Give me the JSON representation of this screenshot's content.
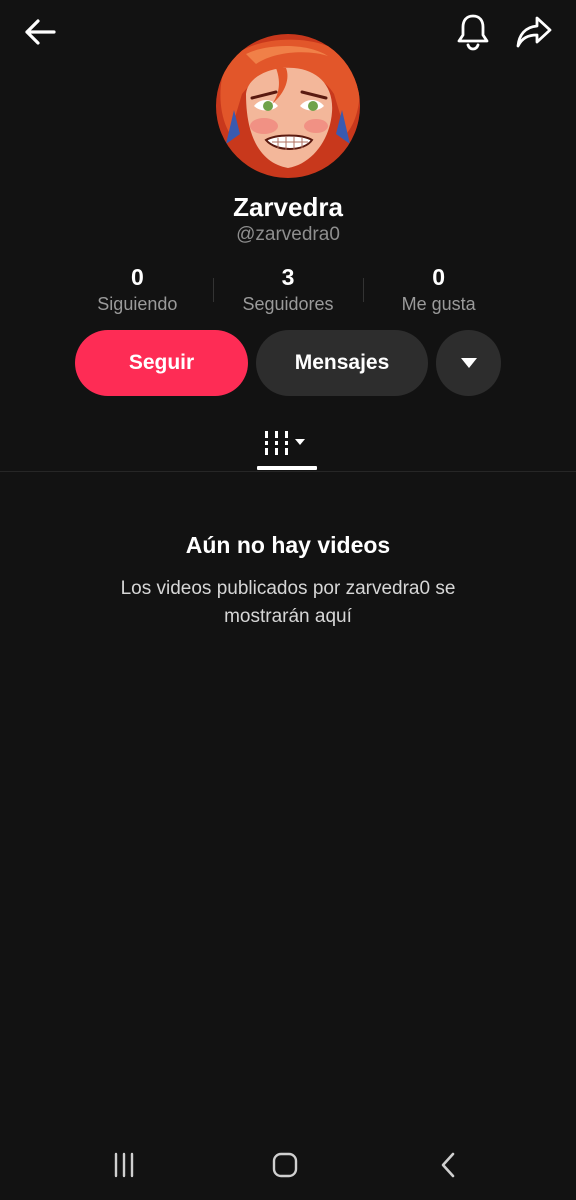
{
  "header": {
    "back_icon": "arrow-left-icon",
    "bell_icon": "bell-icon",
    "share_icon": "share-arrow-icon"
  },
  "profile": {
    "display_name": "Zarvedra",
    "username": "@zarvedra0"
  },
  "stats": [
    {
      "value": "0",
      "label": "Siguiendo"
    },
    {
      "value": "3",
      "label": "Seguidores"
    },
    {
      "value": "0",
      "label": "Me gusta"
    }
  ],
  "actions": {
    "follow_label": "Seguir",
    "message_label": "Mensajes",
    "more_icon": "caret-down-icon"
  },
  "tabs": {
    "videos_icon": "video-grid-icon"
  },
  "empty_state": {
    "title": "Aún no hay videos",
    "description": "Los videos publicados por zarvedra0 se mostrarán aquí"
  },
  "system_nav": {
    "recent_icon": "recent-apps-icon",
    "home_icon": "home-icon",
    "back_icon": "back-chevron-icon"
  },
  "colors": {
    "background": "#121212",
    "accent": "#fe2c55",
    "secondary_button": "#2d2d2d",
    "muted_text": "#8e8e8e"
  }
}
